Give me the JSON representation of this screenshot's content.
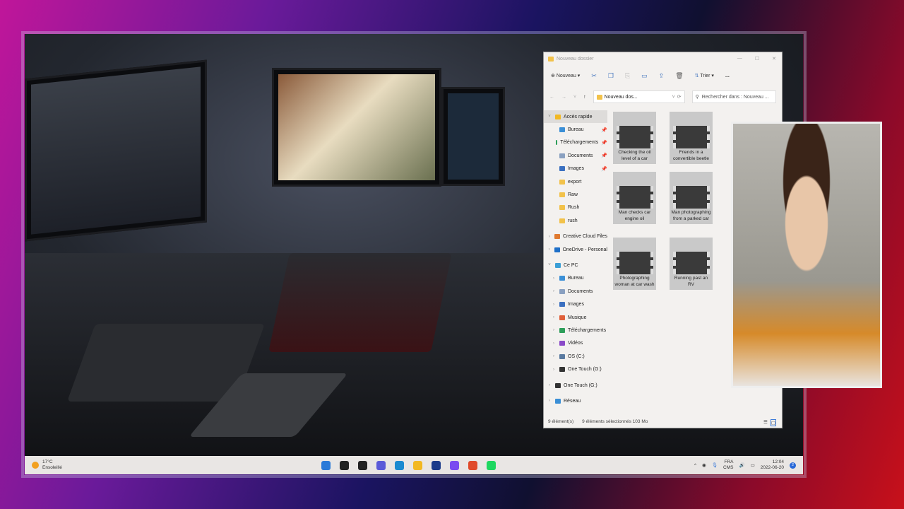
{
  "explorer": {
    "title": "Nouveau dossier",
    "window_controls": [
      "—",
      "☐",
      "✕"
    ],
    "toolbar": {
      "new_label": "Nouveau",
      "sort_label": "Trier",
      "more": "..."
    },
    "address": {
      "path": "Nouveau dos...",
      "search_placeholder": "Rechercher dans : Nouveau ..."
    },
    "nav": [
      {
        "label": "Accès rapide",
        "level": 0,
        "expanded": true,
        "selected": true,
        "color": "#f2b822"
      },
      {
        "label": "Bureau",
        "level": 1,
        "pinned": true,
        "color": "#3b8fd6"
      },
      {
        "label": "Téléchargements",
        "level": 1,
        "pinned": true,
        "color": "#2e9e5a"
      },
      {
        "label": "Documents",
        "level": 1,
        "pinned": true,
        "color": "#8aa0c0"
      },
      {
        "label": "Images",
        "level": 1,
        "pinned": true,
        "color": "#3b70c0"
      },
      {
        "label": "export",
        "level": 1,
        "color": "#f2c24a"
      },
      {
        "label": "Raw",
        "level": 1,
        "color": "#f2c24a"
      },
      {
        "label": "Rush",
        "level": 1,
        "color": "#f2c24a"
      },
      {
        "label": "rush",
        "level": 1,
        "color": "#f2c24a"
      },
      {
        "label": "Creative Cloud Files",
        "level": 0,
        "color": "#e07a30"
      },
      {
        "label": "OneDrive - Personal",
        "level": 0,
        "color": "#1e6fc8"
      },
      {
        "label": "Ce PC",
        "level": 0,
        "expanded": true,
        "color": "#3b9fd6"
      },
      {
        "label": "Bureau",
        "level": 1,
        "color": "#3b8fd6"
      },
      {
        "label": "Documents",
        "level": 1,
        "color": "#8aa0c0"
      },
      {
        "label": "Images",
        "level": 1,
        "color": "#3b70c0"
      },
      {
        "label": "Musique",
        "level": 1,
        "color": "#e0603a"
      },
      {
        "label": "Téléchargements",
        "level": 1,
        "color": "#2e9e5a"
      },
      {
        "label": "Vidéos",
        "level": 1,
        "color": "#8a4ac8"
      },
      {
        "label": "OS (C:)",
        "level": 1,
        "color": "#5a7aa0"
      },
      {
        "label": "One Touch (G:)",
        "level": 1,
        "color": "#333333"
      },
      {
        "label": "One Touch (G:)",
        "level": 0,
        "color": "#333333"
      },
      {
        "label": "Réseau",
        "level": 0,
        "color": "#3b8fd6"
      }
    ],
    "files": [
      {
        "name": "Checking the oil level of a car"
      },
      {
        "name": "Friends in a convertible beetle"
      },
      {
        "name": "Man checks car engine oil"
      },
      {
        "name": "Man photographing from a parked car"
      },
      {
        "name": "Photographing woman at car wash"
      },
      {
        "name": "Running past an RV"
      }
    ],
    "status": {
      "count": "9 élément(s)",
      "selected": "9 éléments sélectionnés",
      "size": "103 Mo"
    }
  },
  "taskbar": {
    "weather": {
      "temp": "17°C",
      "condition": "Ensoleillé"
    },
    "apps": [
      {
        "name": "start",
        "color": "#2a7ad8"
      },
      {
        "name": "search",
        "color": "#222222"
      },
      {
        "name": "task-view",
        "color": "#222222"
      },
      {
        "name": "chat",
        "color": "#5a5ad8"
      },
      {
        "name": "edge",
        "color": "#1a8ad0"
      },
      {
        "name": "file-explorer",
        "color": "#f2b822"
      },
      {
        "name": "store",
        "color": "#1a3a8a"
      },
      {
        "name": "messenger",
        "color": "#7a4af0"
      },
      {
        "name": "brave",
        "color": "#e04a2a"
      },
      {
        "name": "spotify",
        "color": "#1ed760"
      }
    ],
    "lang": "FRA",
    "layout": "CMS",
    "time": "12:04",
    "date": "2022-06-20",
    "notifications": "2"
  }
}
